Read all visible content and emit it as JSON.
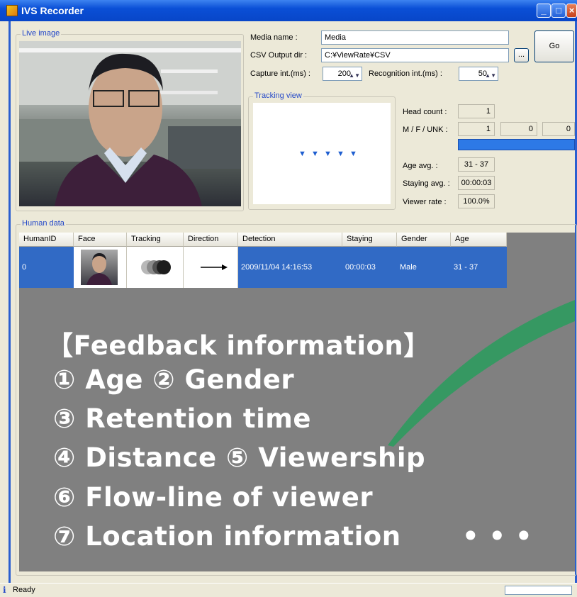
{
  "window": {
    "title": "IVS Recorder"
  },
  "groups": {
    "live_image": "Live image",
    "tracking_view": "Tracking view",
    "human_data": "Human data"
  },
  "settings": {
    "media_name_label": "Media name :",
    "media_name_value": "Media",
    "csv_dir_label": "CSV Output dir :",
    "csv_dir_value": "C:¥ViewRate¥CSV",
    "browse_label": "...",
    "go_label": "Go",
    "capture_label": "Capture int.(ms) :",
    "capture_value": "200",
    "recognition_label": "Recognition int.(ms) :",
    "recognition_value": "50"
  },
  "stats": {
    "head_count_label": "Head count :",
    "head_count_value": "1",
    "mfu_label": "M / F / UNK :",
    "male_value": "1",
    "female_value": "0",
    "unknown_value": "0",
    "age_avg_label": "Age avg. :",
    "age_avg_value": "31 - 37",
    "staying_avg_label": "Staying avg. :",
    "staying_avg_value": "00:00:03",
    "viewer_rate_label": "Viewer rate :",
    "viewer_rate_value": "100.0%"
  },
  "table": {
    "columns": [
      "HumanID",
      "Face",
      "Tracking",
      "Direction",
      "Detection",
      "Staying",
      "Gender",
      "Age"
    ],
    "row": {
      "human_id": "0",
      "detection": "2009/11/04 14:16:53",
      "staying": "00:00:03",
      "gender": "Male",
      "age": "31 - 37"
    }
  },
  "overlay": {
    "lines": [
      "【Feedback information】",
      "① Age ② Gender",
      "③ Retention time",
      "④ Distance ⑤ Viewership",
      "⑥ Flow-line of viewer",
      "⑦ Location information"
    ],
    "ellipsis": "• • •"
  },
  "status": {
    "text": "Ready"
  },
  "colors": {
    "selection": "#316ac5",
    "titlebar": "#0a4fd6",
    "accent_green": "#2e9a5e"
  }
}
